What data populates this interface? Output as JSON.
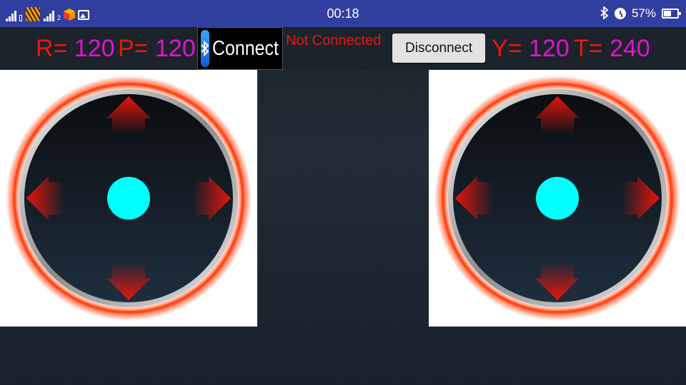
{
  "status_bar": {
    "time": "00:18",
    "sim2_label": "2",
    "battery_percent": "57%",
    "battery_level": 0.57,
    "icons": [
      "signal-icon",
      "signal-icon",
      "tiger-app-icon",
      "box-app-icon",
      "gallery-icon",
      "bluetooth-icon",
      "alarm-icon",
      "battery-icon"
    ]
  },
  "controls": {
    "roll": {
      "label": "R=",
      "value": "120"
    },
    "pitch": {
      "label": "P=",
      "value": "120"
    },
    "yaw": {
      "label": "Y=",
      "value": "120"
    },
    "throttle": {
      "label": "T=",
      "value": "240"
    },
    "connect_label": "Connect",
    "connection_status": "Not Connected",
    "disconnect_label": "Disconnect"
  },
  "joysticks": {
    "left": {
      "knob_x": 0,
      "knob_y": 0
    },
    "right": {
      "knob_x": 0,
      "knob_y": 0
    }
  },
  "colors": {
    "status_bar": "#303f9f",
    "label_red": "#e8170e",
    "value_magenta": "#e014d4",
    "knob_cyan": "#00ffff",
    "ring_glow": "#ff4a1a",
    "arrow_red": "#e8150e"
  }
}
